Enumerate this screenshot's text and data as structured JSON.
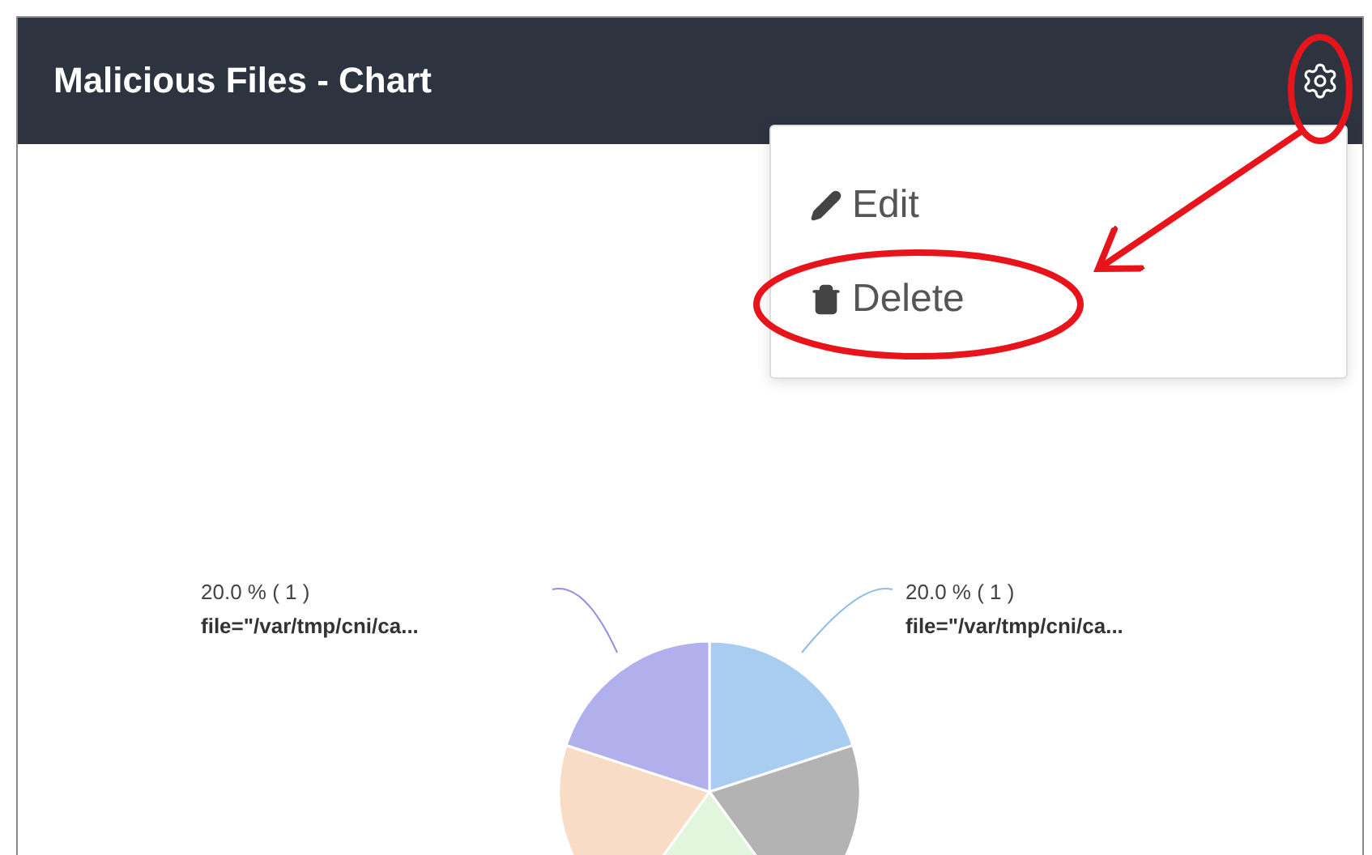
{
  "panel": {
    "title": "Malicious Files - Chart"
  },
  "menu": {
    "open": true,
    "items": [
      {
        "kind": "edit",
        "label": "Edit"
      },
      {
        "kind": "delete",
        "label": "Delete"
      }
    ]
  },
  "chart": {
    "slices": [
      {
        "color": "#a9cdf0"
      },
      {
        "color": "#b3b3b3"
      },
      {
        "color": "#e2f6de"
      },
      {
        "color": "#f9dcc5"
      },
      {
        "color": "#b2b0ec"
      }
    ],
    "labels": [
      {
        "percent": "20.0 % ( 1 )",
        "name": "file=\"/var/tmp/cni/ca..."
      },
      {
        "percent": "20.0 % ( 1 )",
        "name": "file=\"/var/tmp/cni/ca..."
      }
    ],
    "chart_data": {
      "type": "pie",
      "values": [
        20,
        20,
        20,
        20,
        20
      ]
    }
  }
}
